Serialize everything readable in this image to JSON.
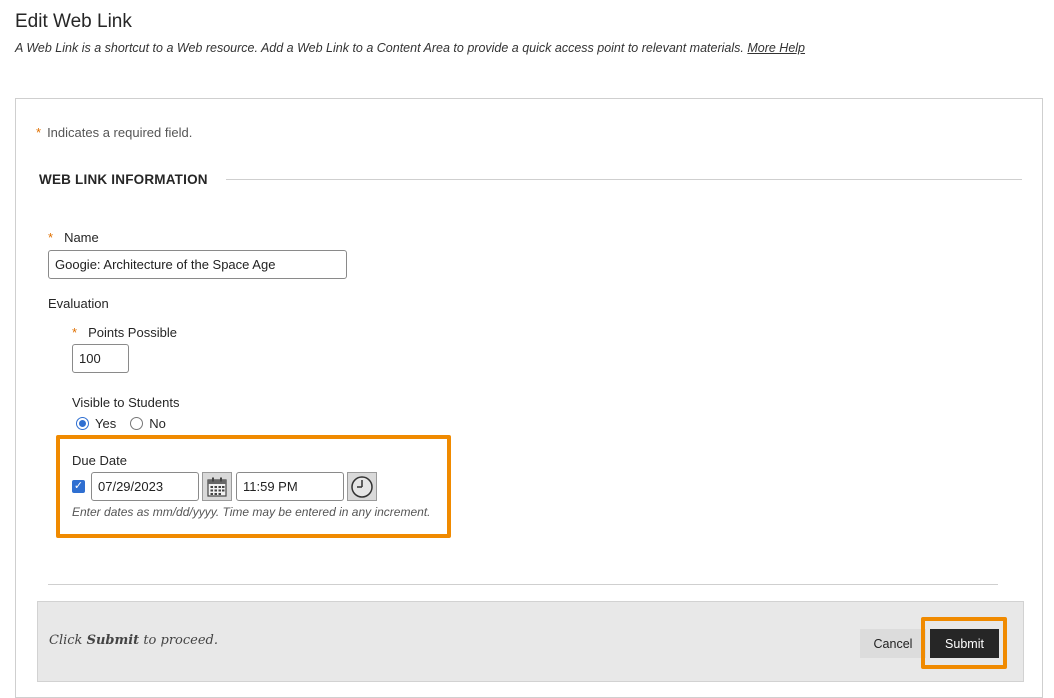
{
  "header": {
    "title": "Edit Web Link",
    "description": "A Web Link is a shortcut to a Web resource. Add a Web Link to a Content Area to provide a quick access point to relevant materials.",
    "more_help": "More Help"
  },
  "form": {
    "required_star": "*",
    "required_note": "Indicates a required field.",
    "section_title": "WEB LINK INFORMATION",
    "name_label": "Name",
    "name_value": "Googie: Architecture of the Space Age",
    "evaluation_label": "Evaluation",
    "points_label": "Points Possible",
    "points_value": "100",
    "visible_label": "Visible to Students",
    "visible_options": [
      "Yes",
      "No"
    ],
    "visible_selected": "Yes",
    "due_date_label": "Due Date",
    "due_date_checked": true,
    "due_date_value": "07/29/2023",
    "due_time_value": "11:59 PM",
    "date_hint": "Enter dates as mm/dd/yyyy. Time may be entered in any increment."
  },
  "footer": {
    "prompt_prefix": "Click ",
    "prompt_bold": "Submit",
    "prompt_suffix": " to proceed.",
    "cancel_label": "Cancel",
    "submit_label": "Submit"
  },
  "icons": [
    "calendar-icon",
    "clock-icon",
    "checkmark-icon"
  ],
  "colors": {
    "required": "#e07000",
    "highlight": "#f08a00",
    "accent": "#2f6fd1",
    "submit_bg": "#262626"
  }
}
